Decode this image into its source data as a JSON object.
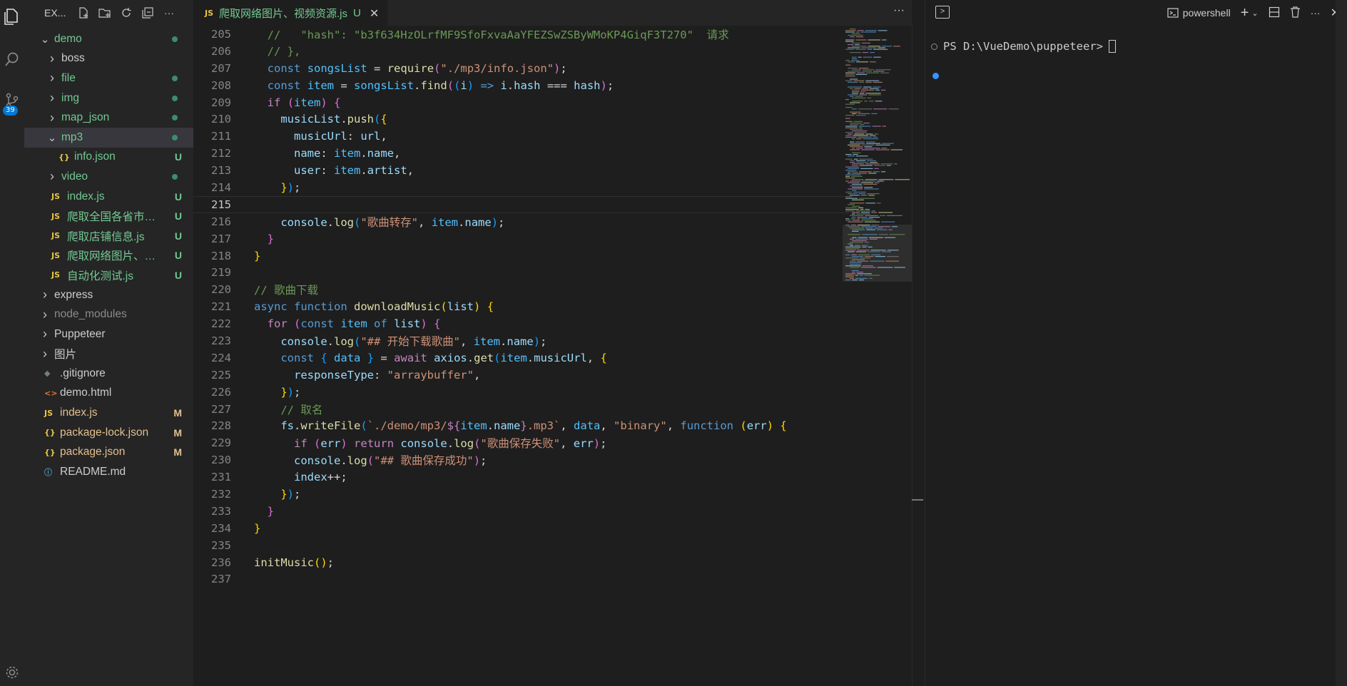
{
  "activity": {
    "badge": "39"
  },
  "explorer": {
    "title": "EX...",
    "tree": [
      {
        "label": "demo",
        "indent": 1,
        "chev": "v",
        "icon": "",
        "status": "dot",
        "cls": "green"
      },
      {
        "label": "boss",
        "indent": 2,
        "chev": ">",
        "icon": "",
        "status": "",
        "cls": ""
      },
      {
        "label": "file",
        "indent": 2,
        "chev": ">",
        "icon": "",
        "status": "dot",
        "cls": "green"
      },
      {
        "label": "img",
        "indent": 2,
        "chev": ">",
        "icon": "",
        "status": "dot",
        "cls": "green"
      },
      {
        "label": "map_json",
        "indent": 2,
        "chev": ">",
        "icon": "",
        "status": "dot",
        "cls": "green"
      },
      {
        "label": "mp3",
        "indent": 2,
        "chev": "v",
        "icon": "",
        "status": "dot",
        "cls": "green",
        "selected": true
      },
      {
        "label": "info.json",
        "indent": 3,
        "chev": "",
        "icon": "{}",
        "status": "U",
        "cls": "green"
      },
      {
        "label": "video",
        "indent": 2,
        "chev": ">",
        "icon": "",
        "status": "dot",
        "cls": "green"
      },
      {
        "label": "index.js",
        "indent": 2,
        "chev": "",
        "icon": "JS",
        "status": "U",
        "cls": "green"
      },
      {
        "label": "爬取全国各省市县...",
        "indent": 2,
        "chev": "",
        "icon": "JS",
        "status": "U",
        "cls": "green"
      },
      {
        "label": "爬取店铺信息.js",
        "indent": 2,
        "chev": "",
        "icon": "JS",
        "status": "U",
        "cls": "green"
      },
      {
        "label": "爬取网络图片、视...",
        "indent": 2,
        "chev": "",
        "icon": "JS",
        "status": "U",
        "cls": "green"
      },
      {
        "label": "自动化测试.js",
        "indent": 2,
        "chev": "",
        "icon": "JS",
        "status": "U",
        "cls": "green"
      },
      {
        "label": "express",
        "indent": 1,
        "chev": ">",
        "icon": "",
        "status": "",
        "cls": ""
      },
      {
        "label": "node_modules",
        "indent": 1,
        "chev": ">",
        "icon": "",
        "status": "",
        "cls": "dim"
      },
      {
        "label": "Puppeteer",
        "indent": 1,
        "chev": ">",
        "icon": "",
        "status": "",
        "cls": ""
      },
      {
        "label": "图片",
        "indent": 1,
        "chev": ">",
        "icon": "",
        "status": "",
        "cls": ""
      },
      {
        "label": ".gitignore",
        "indent": 1,
        "chev": "",
        "icon": "git",
        "status": "",
        "cls": ""
      },
      {
        "label": "demo.html",
        "indent": 1,
        "chev": "",
        "icon": "<>",
        "status": "",
        "cls": ""
      },
      {
        "label": "index.js",
        "indent": 1,
        "chev": "",
        "icon": "JS",
        "status": "M",
        "cls": "mod"
      },
      {
        "label": "package-lock.json",
        "indent": 1,
        "chev": "",
        "icon": "{}",
        "status": "M",
        "cls": "mod"
      },
      {
        "label": "package.json",
        "indent": 1,
        "chev": "",
        "icon": "{}",
        "status": "M",
        "cls": "mod"
      },
      {
        "label": "README.md",
        "indent": 1,
        "chev": "",
        "icon": "i",
        "status": "",
        "cls": ""
      }
    ]
  },
  "editor": {
    "tab": {
      "icon": "JS",
      "name": "爬取网络图片、视频资源.js",
      "status": "U"
    },
    "current_line": 215,
    "lines": [
      {
        "n": 205,
        "html": "  <span class='c'>//   \"hash\": \"b3f634HzOLrfMF9SfoFxvaAaYFEZSwZSByWMoKP4GiqF3T270\"  请求</span>"
      },
      {
        "n": 206,
        "html": "  <span class='c'>// },</span>"
      },
      {
        "n": 207,
        "html": "  <span class='k'>const</span> <span class='cn'>songsList</span> <span class='p'>=</span> <span class='f'>require</span><span class='b2'>(</span><span class='s'>\"./mp3/info.json\"</span><span class='b2'>)</span><span class='p'>;</span>"
      },
      {
        "n": 208,
        "html": "  <span class='k'>const</span> <span class='cn'>item</span> <span class='p'>=</span> <span class='cn'>songsList</span><span class='p'>.</span><span class='f'>find</span><span class='b2'>(</span><span class='b3'>(</span><span class='v'>i</span><span class='b3'>)</span> <span class='k'>=&gt;</span> <span class='v'>i</span><span class='p'>.</span><span class='v'>hash</span> <span class='p'>===</span> <span class='v'>hash</span><span class='b2'>)</span><span class='p'>;</span>"
      },
      {
        "n": 209,
        "html": "  <span class='kc'>if</span> <span class='b2'>(</span><span class='cn'>item</span><span class='b2'>)</span> <span class='b2'>{</span>"
      },
      {
        "n": 210,
        "html": "    <span class='v'>musicList</span><span class='p'>.</span><span class='f'>push</span><span class='b3'>(</span><span class='b1'>{</span>"
      },
      {
        "n": 211,
        "html": "      <span class='v'>musicUrl</span><span class='p'>: </span><span class='v'>url</span><span class='p'>,</span>"
      },
      {
        "n": 212,
        "html": "      <span class='v'>name</span><span class='p'>: </span><span class='cn'>item</span><span class='p'>.</span><span class='v'>name</span><span class='p'>,</span>"
      },
      {
        "n": 213,
        "html": "      <span class='v'>user</span><span class='p'>: </span><span class='cn'>item</span><span class='p'>.</span><span class='v'>artist</span><span class='p'>,</span>"
      },
      {
        "n": 214,
        "html": "    <span class='b1'>}</span><span class='b3'>)</span><span class='p'>;</span>"
      },
      {
        "n": 215,
        "html": ""
      },
      {
        "n": 216,
        "html": "    <span class='v'>console</span><span class='p'>.</span><span class='f'>log</span><span class='b3'>(</span><span class='s'>\"歌曲转存\"</span><span class='p'>, </span><span class='cn'>item</span><span class='p'>.</span><span class='v'>name</span><span class='b3'>)</span><span class='p'>;</span>"
      },
      {
        "n": 217,
        "html": "  <span class='b2'>}</span>"
      },
      {
        "n": 218,
        "html": "<span class='b1'>}</span>"
      },
      {
        "n": 219,
        "html": ""
      },
      {
        "n": 220,
        "html": "<span class='c'>// 歌曲下载</span>"
      },
      {
        "n": 221,
        "html": "<span class='k'>async</span> <span class='k'>function</span> <span class='f'>downloadMusic</span><span class='b1'>(</span><span class='v'>list</span><span class='b1'>)</span> <span class='b1'>{</span>"
      },
      {
        "n": 222,
        "html": "  <span class='kc'>for</span> <span class='b2'>(</span><span class='k'>const</span> <span class='cn'>item</span> <span class='k'>of</span> <span class='v'>list</span><span class='b2'>)</span> <span class='b2'>{</span>"
      },
      {
        "n": 223,
        "html": "    <span class='v'>console</span><span class='p'>.</span><span class='f'>log</span><span class='b3'>(</span><span class='s'>\"## 开始下载歌曲\"</span><span class='p'>, </span><span class='cn'>item</span><span class='p'>.</span><span class='v'>name</span><span class='b3'>)</span><span class='p'>;</span>"
      },
      {
        "n": 224,
        "html": "    <span class='k'>const</span> <span class='b3'>{</span> <span class='cn'>data</span> <span class='b3'>}</span> <span class='p'>=</span> <span class='kc'>await</span> <span class='v'>axios</span><span class='p'>.</span><span class='f'>get</span><span class='b3'>(</span><span class='cn'>item</span><span class='p'>.</span><span class='v'>musicUrl</span><span class='p'>, </span><span class='b1'>{</span>"
      },
      {
        "n": 225,
        "html": "      <span class='v'>responseType</span><span class='p'>: </span><span class='s'>\"arraybuffer\"</span><span class='p'>,</span>"
      },
      {
        "n": 226,
        "html": "    <span class='b1'>}</span><span class='b3'>)</span><span class='p'>;</span>"
      },
      {
        "n": 227,
        "html": "    <span class='c'>// 取名</span>"
      },
      {
        "n": 228,
        "html": "    <span class='v'>fs</span><span class='p'>.</span><span class='f'>writeFile</span><span class='b3'>(</span><span class='s'>`./demo/mp3/</span><span class='kc'>${</span><span class='cn'>item</span><span class='p'>.</span><span class='v'>name</span><span class='kc'>}</span><span class='s'>.mp3`</span><span class='p'>, </span><span class='cn'>data</span><span class='p'>, </span><span class='s'>\"binary\"</span><span class='p'>, </span><span class='k'>function</span> <span class='b1'>(</span><span class='v'>err</span><span class='b1'>)</span> <span class='b1'>{</span>"
      },
      {
        "n": 229,
        "html": "      <span class='kc'>if</span> <span class='b2'>(</span><span class='v'>err</span><span class='b2'>)</span> <span class='kc'>return</span> <span class='v'>console</span><span class='p'>.</span><span class='f'>log</span><span class='b2'>(</span><span class='s'>\"歌曲保存失败\"</span><span class='p'>, </span><span class='v'>err</span><span class='b2'>)</span><span class='p'>;</span>"
      },
      {
        "n": 230,
        "html": "      <span class='v'>console</span><span class='p'>.</span><span class='f'>log</span><span class='b2'>(</span><span class='s'>\"## 歌曲保存成功\"</span><span class='b2'>)</span><span class='p'>;</span>"
      },
      {
        "n": 231,
        "html": "      <span class='v'>index</span><span class='p'>++;</span>"
      },
      {
        "n": 232,
        "html": "    <span class='b1'>}</span><span class='b3'>)</span><span class='p'>;</span>"
      },
      {
        "n": 233,
        "html": "  <span class='b2'>}</span>"
      },
      {
        "n": 234,
        "html": "<span class='b1'>}</span>"
      },
      {
        "n": 235,
        "html": ""
      },
      {
        "n": 236,
        "html": "<span class='f'>initMusic</span><span class='b1'>()</span><span class='p'>;</span>"
      },
      {
        "n": 237,
        "html": ""
      }
    ]
  },
  "terminal": {
    "shell_label": "powershell",
    "prompt": "PS D:\\VueDemo\\puppeteer>"
  }
}
